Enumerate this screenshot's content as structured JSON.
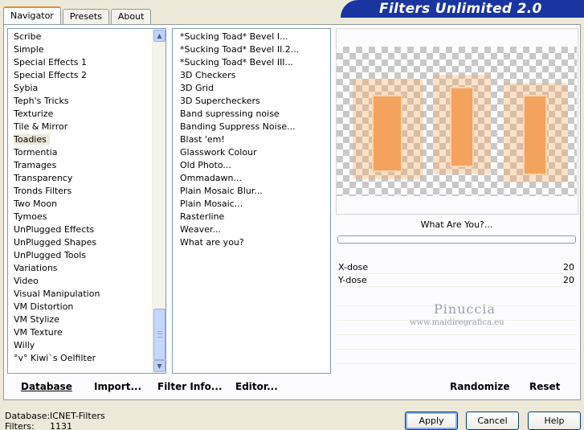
{
  "tabs": [
    {
      "label": "Navigator"
    },
    {
      "label": "Presets"
    },
    {
      "label": "About"
    }
  ],
  "title": "Filters Unlimited 2.0",
  "categories": [
    {
      "label": "Scribe"
    },
    {
      "label": "Simple"
    },
    {
      "label": "Special Effects 1"
    },
    {
      "label": "Special Effects 2"
    },
    {
      "label": "Sybia"
    },
    {
      "label": "Teph's Tricks"
    },
    {
      "label": "Texturize"
    },
    {
      "label": "Tile & Mirror"
    },
    {
      "label": "Toadies"
    },
    {
      "label": "Tormentia"
    },
    {
      "label": "Tramages"
    },
    {
      "label": "Transparency"
    },
    {
      "label": "Tronds Filters"
    },
    {
      "label": "Two Moon"
    },
    {
      "label": "Tymoes"
    },
    {
      "label": "UnPlugged Effects"
    },
    {
      "label": "UnPlugged Shapes"
    },
    {
      "label": "UnPlugged Tools"
    },
    {
      "label": "Variations"
    },
    {
      "label": "Video"
    },
    {
      "label": "Visual Manipulation"
    },
    {
      "label": "VM Distortion"
    },
    {
      "label": "VM Stylize"
    },
    {
      "label": "VM Texture"
    },
    {
      "label": "Willy"
    },
    {
      "label": "°v° Kiwi`s Oelfilter"
    }
  ],
  "selected_category": "Toadies",
  "filters": [
    {
      "label": "*Sucking Toad*  Bevel I..."
    },
    {
      "label": "*Sucking Toad*  Bevel II.2..."
    },
    {
      "label": "*Sucking Toad*  Bevel III..."
    },
    {
      "label": "3D Checkers"
    },
    {
      "label": "3D Grid"
    },
    {
      "label": "3D Supercheckers"
    },
    {
      "label": "Band supressing noise"
    },
    {
      "label": "Banding Suppress Noise..."
    },
    {
      "label": "Blast 'em!"
    },
    {
      "label": "Glasswork Colour"
    },
    {
      "label": "Old Photo..."
    },
    {
      "label": "Ommadawn..."
    },
    {
      "label": "Plain Mosaic Blur..."
    },
    {
      "label": "Plain Mosaic..."
    },
    {
      "label": "Rasterline"
    },
    {
      "label": "Weaver..."
    },
    {
      "label": "What are you?"
    }
  ],
  "selected_filter": "What are you?",
  "filter_name": "What Are You?...",
  "progress": 0,
  "params": [
    {
      "label": "X-dose",
      "value": "20"
    },
    {
      "label": "Y-dose",
      "value": "20"
    }
  ],
  "watermark": {
    "line1": "Pinuccia",
    "line2": "www.maidiregrafica.eu"
  },
  "toolbar": {
    "database": "Database",
    "import": "Import...",
    "filter_info": "Filter Info...",
    "editor": "Editor...",
    "randomize": "Randomize",
    "reset": "Reset"
  },
  "status": {
    "database_label": "Database:",
    "database_value": "ICNET-Filters",
    "filters_label": "Filters:",
    "filters_value": "1131"
  },
  "buttons": {
    "apply": "Apply",
    "cancel": "Cancel",
    "help": "Help"
  },
  "colors": {
    "title_banner": "#1a35a0",
    "selection": "#316ac5",
    "preview_shape": "#f4a35f"
  }
}
